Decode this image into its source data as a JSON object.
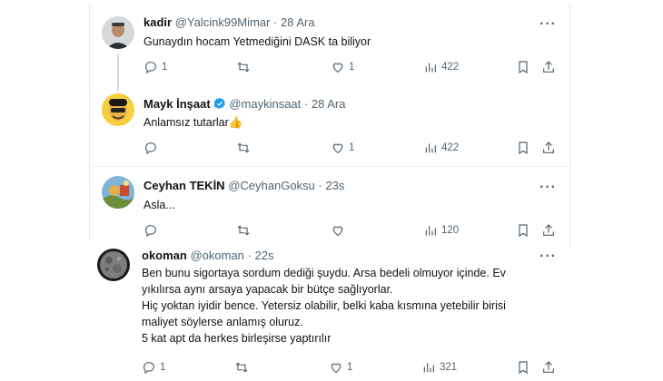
{
  "tweets": [
    {
      "name": "kadir",
      "handle": "@Yalcink99Mimar",
      "dot": "·",
      "time": "28 Ara",
      "lines": [
        "Gunaydın hocam Yetmediğini DASK ta biliyor"
      ],
      "stats": {
        "replies": "1",
        "retweets": "",
        "likes": "1",
        "views": "422"
      }
    },
    {
      "name": "Mayk İnşaat",
      "handle": "@maykinsaat",
      "dot": "·",
      "time": "28 Ara",
      "lines": [
        "Anlamsız tutarlar👍"
      ],
      "stats": {
        "replies": "",
        "retweets": "",
        "likes": "1",
        "views": "422"
      }
    },
    {
      "name": "Ceyhan TEKİN",
      "handle": "@CeyhanGoksu",
      "dot": "·",
      "time": "23s",
      "lines": [
        "Asla..."
      ],
      "stats": {
        "replies": "",
        "retweets": "",
        "likes": "",
        "views": "120"
      }
    },
    {
      "name": "okoman",
      "handle": "@okoman",
      "dot": "·",
      "time": "22s",
      "lines": [
        "Ben bunu sigortaya sordum  dediği şuydu. Arsa bedeli olmuyor içinde. Ev",
        "yıkılırsa aynı arsaya yapacak bir bütçe sağlıyorlar.",
        "Hiç yoktan iyidir bence. Yetersiz olabilir, belki kaba kısmına yetebilir birisi",
        "maliyet söylerse anlamış oluruz.",
        "5 kat apt da herkes birleşirse yaptırılır"
      ],
      "stats": {
        "replies": "1",
        "retweets": "",
        "likes": "1",
        "views": "321"
      }
    }
  ],
  "icons": {
    "more": "more-icon",
    "reply": "reply-icon",
    "retweet": "retweet-icon",
    "like": "heart-icon",
    "views": "views-icon",
    "bookmark": "bookmark-icon",
    "share": "share-icon",
    "verified": "verified-badge-icon"
  },
  "colors": {
    "text": "#0f1419",
    "muted": "#536471",
    "verified": "#1d9bf0",
    "divider": "#eff3f4"
  },
  "more_glyph": "···"
}
